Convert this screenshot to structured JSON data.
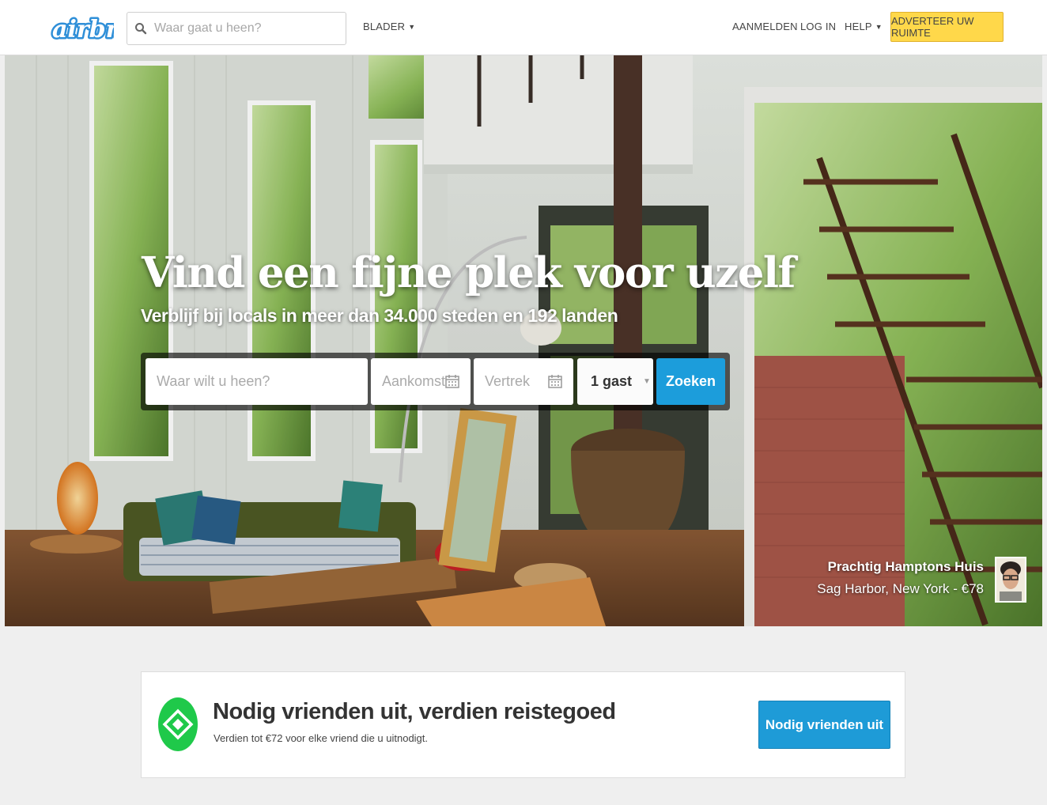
{
  "header": {
    "logo_text": "airbnb",
    "search_placeholder": "Waar gaat u heen?",
    "browse_label": "BLADER",
    "signup_label": "AANMELDEN",
    "login_label": "LOG IN",
    "help_label": "HELP",
    "host_cta_label": "ADVERTEER UW RUIMTE"
  },
  "hero": {
    "title": "Vind een fijne plek voor uzelf",
    "subtitle": "Verblijf bij locals in meer dan 34.000 steden en 192 landen",
    "search": {
      "where_placeholder": "Waar wilt u heen?",
      "checkin_placeholder": "Aankomst",
      "checkout_placeholder": "Vertrek",
      "guests_value": "1 gast",
      "submit_label": "Zoeken"
    },
    "listing": {
      "name": "Prachtig Hamptons Huis",
      "location_price": "Sag Harbor, New York - €78"
    }
  },
  "invite": {
    "title": "Nodig vrienden uit, verdien reistegoed",
    "subtitle": "Verdien tot €72 voor elke vriend die u uitnodigt.",
    "button_label": "Nodig vrienden uit"
  },
  "colors": {
    "brand_blue": "#1c9ddb",
    "cta_yellow": "#ffd84a",
    "badge_green": "#1fc94a"
  },
  "icons": {
    "search": "magnifier-icon",
    "calendar": "calendar-icon",
    "dropdown": "caret-down-icon",
    "badge": "diamond-badge-icon"
  }
}
